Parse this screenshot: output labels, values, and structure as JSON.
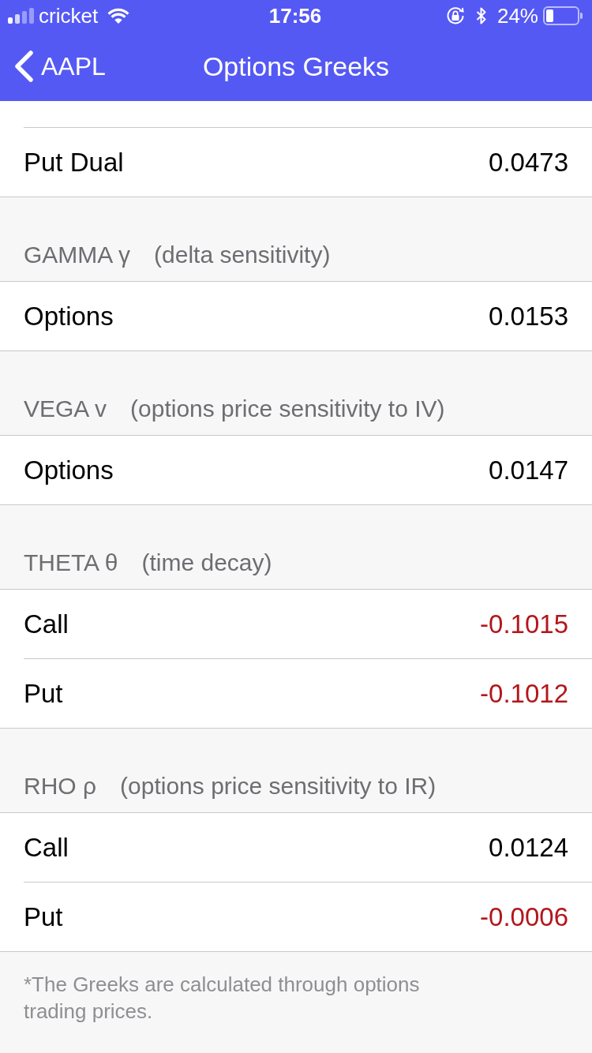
{
  "status_bar": {
    "carrier": "cricket",
    "time": "17:56",
    "battery": "24%"
  },
  "nav": {
    "back": "AAPL",
    "title": "Options Greeks"
  },
  "sections": [
    {
      "rows": [
        {
          "kind": "clipped"
        },
        {
          "kind": "item",
          "label": "Put Dual",
          "value": "0.0473",
          "color": "#000000"
        }
      ]
    },
    {
      "name": "GAMMA γ",
      "description": "(delta sensitivity)",
      "rows": [
        {
          "kind": "item",
          "label": "Options",
          "value": "0.0153",
          "color": "#000000"
        }
      ]
    },
    {
      "name": "VEGA v",
      "description": "(options price sensitivity to IV)",
      "rows": [
        {
          "kind": "item",
          "label": "Options",
          "value": "0.0147",
          "color": "#000000"
        }
      ]
    },
    {
      "name": "THETA θ",
      "description": "(time decay)",
      "rows": [
        {
          "kind": "item",
          "label": "Call",
          "value": "-0.1015",
          "color": "#b3161c"
        },
        {
          "kind": "item",
          "label": "Put",
          "value": "-0.1012",
          "color": "#b3161c"
        }
      ]
    },
    {
      "name": "RHO ρ",
      "description": "(options price sensitivity to IR)",
      "rows": [
        {
          "kind": "item",
          "label": "Call",
          "value": "0.0124",
          "color": "#000000"
        },
        {
          "kind": "item",
          "label": "Put",
          "value": "-0.0006",
          "color": "#b3161c"
        }
      ]
    }
  ],
  "footnote": "*The Greeks are calculated through options trading prices."
}
